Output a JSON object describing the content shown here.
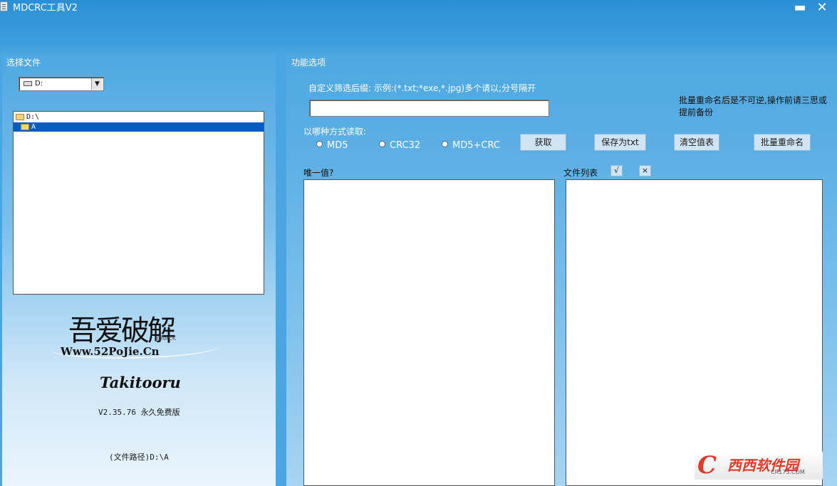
{
  "window": {
    "title": "MDCRC工具V2",
    "minimize_glyph": "▬",
    "close_glyph": "✕"
  },
  "left": {
    "title": "选择文件",
    "drive": {
      "value": "D:",
      "arrow": "▼"
    },
    "tree": [
      {
        "label": "D:\\",
        "selected": false
      },
      {
        "label": "A",
        "selected": true
      }
    ],
    "logo": {
      "main": "吾爱破解",
      "crack": "CRACK",
      "url": "Www.52PoJie.Cn"
    },
    "author": "Takitooru",
    "version": "V2.35.76 永久免费版",
    "filepath": "(文件路径)D:\\A"
  },
  "right": {
    "title": "功能选项",
    "filter_label": "自定义筛选后缀: 示例:(*.txt;*exe,*.jpg)多个请以;分号隔开",
    "filter_value": "",
    "warning": "批量重命名后是不可逆,操作前请三思或提前备份",
    "read_label": "以哪种方式读取:",
    "radios": [
      "MD5",
      "CRC32",
      "MD5+CRC"
    ],
    "buttons": {
      "get": "获取",
      "save": "保存为txt",
      "clear": "清空值表",
      "rename": "批量重命名"
    },
    "unique_label": "唯一值?",
    "filelist_label": "文件列表",
    "check_glyph": "√",
    "x_glyph": "×"
  },
  "watermark": {
    "logo": "C",
    "text": "西西软件园",
    "url": "CR173.COM"
  },
  "colors": {
    "background": "#3d9ddd",
    "selection": "#0a5cc2",
    "watermark": "#e03a2a"
  }
}
